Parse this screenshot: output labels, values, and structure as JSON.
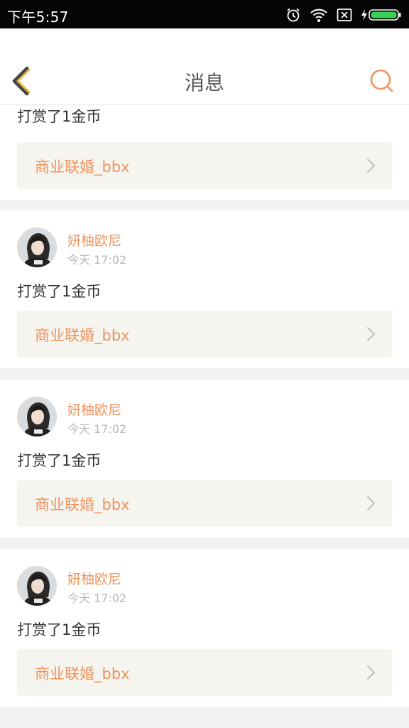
{
  "status_bar": {
    "time": "下午5:57"
  },
  "header": {
    "title": "消息",
    "back_icon": "chevron-left-icon",
    "search_icon": "search-icon"
  },
  "colors": {
    "accent": "#f0935e",
    "back_accent": "#e8b53a",
    "link_box_bg": "#f5f4ee",
    "separator": "#f2f2f0"
  },
  "first_card": {
    "message": "打赏了1金币",
    "link_label": "商业联婚_bbx"
  },
  "items": [
    {
      "username": "妍柚欧尼",
      "time": "今天 17:02",
      "message": "打赏了1金币",
      "link_label": "商业联婚_bbx"
    },
    {
      "username": "妍柚欧尼",
      "time": "今天 17:02",
      "message": "打赏了1金币",
      "link_label": "商业联婚_bbx"
    },
    {
      "username": "妍柚欧尼",
      "time": "今天 17:02",
      "message": "打赏了1金币",
      "link_label": "商业联婚_bbx"
    }
  ]
}
